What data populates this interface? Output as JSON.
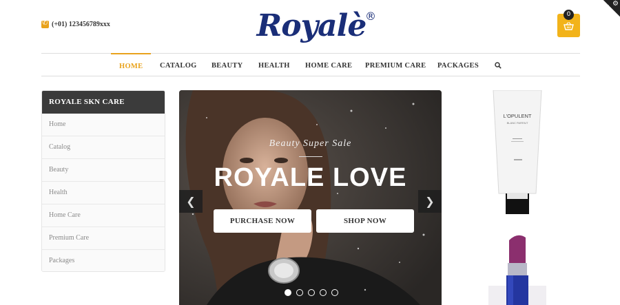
{
  "header": {
    "phone": "(+01) 123456789xxx",
    "logo": "Royalè",
    "logo_mark": "®",
    "cart_count": "0"
  },
  "nav": {
    "items": [
      "HOME",
      "CATALOG",
      "BEAUTY",
      "HEALTH",
      "HOME CARE",
      "PREMIUM CARE",
      "PACKAGES"
    ],
    "active": "HOME"
  },
  "sidebar": {
    "title": "ROYALE SKN CARE",
    "items": [
      "Home",
      "Catalog",
      "Beauty",
      "Health",
      "Home Care",
      "Premium Care",
      "Packages"
    ]
  },
  "slider": {
    "subtitle": "Beauty Super Sale",
    "title": "ROYALE LOVE",
    "buttons": [
      "PURCHASE NOW",
      "SHOP NOW"
    ],
    "prev_icon": "❮",
    "next_icon": "❯",
    "slide_count": 5,
    "current_slide": 1
  },
  "products": [
    {
      "brand": "L'OPULENT",
      "line": "BLANC PARFAIT"
    }
  ],
  "colors": {
    "accent": "#f2b31a",
    "logo": "#1a2e78",
    "sidebar_header": "#3b3b3b"
  }
}
